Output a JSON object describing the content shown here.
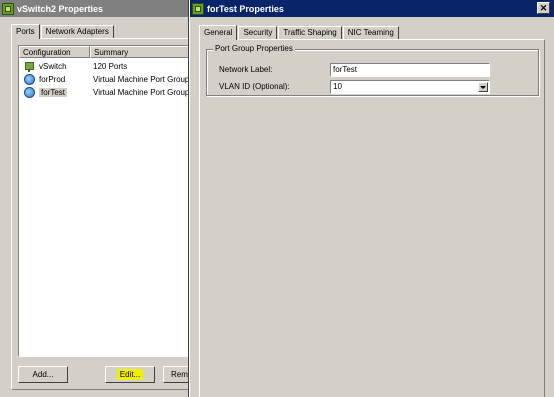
{
  "vswitch_window": {
    "title": "vSwitch2 Properties",
    "tabs": [
      "Ports",
      "Network Adapters"
    ],
    "columns": [
      "Configuration",
      "Summary"
    ],
    "rows": [
      {
        "name": "vSwitch",
        "summary": "120 Ports",
        "icon": "vswitch-icon"
      },
      {
        "name": "forProd",
        "summary": "Virtual Machine Port Group",
        "icon": "port-group-icon"
      },
      {
        "name": "forTest",
        "summary": "Virtual Machine Port Group",
        "icon": "port-group-icon",
        "selected": true
      }
    ],
    "buttons": {
      "add": "Add...",
      "edit": "Edit...",
      "remove": "Remo"
    }
  },
  "portgroup_window": {
    "title": "forTest Properties",
    "close_glyph": "✕",
    "tabs": [
      "General",
      "Security",
      "Traffic Shaping",
      "NIC Teaming"
    ],
    "group_title": "Port Group Properties",
    "network_label_caption": "Network Label:",
    "network_label_value": "forTest",
    "vlan_caption": "VLAN ID (Optional):",
    "vlan_value": "10"
  },
  "colors": {
    "active_title": "#0a246a",
    "inactive_title": "#808080",
    "highlight": "#f0f000"
  }
}
